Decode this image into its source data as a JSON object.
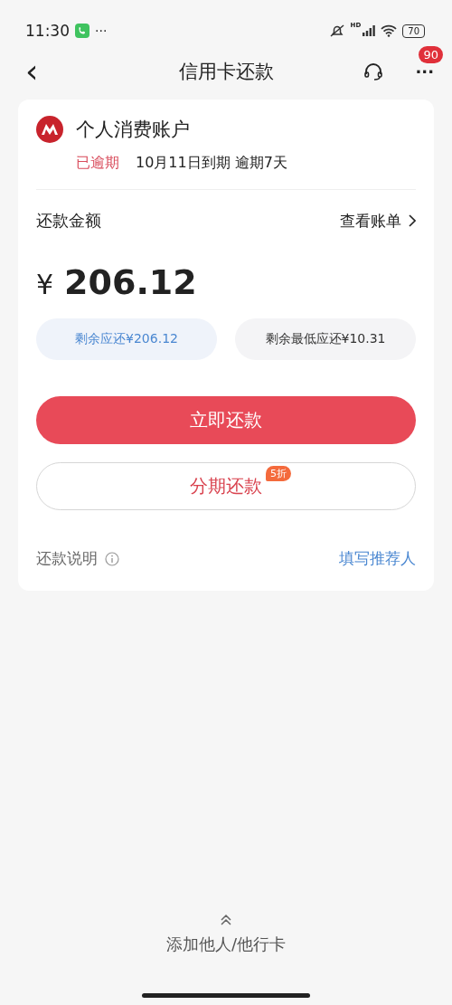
{
  "status_bar": {
    "time": "11:30",
    "more": "···",
    "network": "HD",
    "battery": "70"
  },
  "nav": {
    "back": "‹",
    "title": "信用卡还款",
    "more": "···",
    "badge": "90"
  },
  "account": {
    "name": "个人消费账户",
    "status": "已逾期",
    "due": "10月11日到期 逾期7天"
  },
  "amount_section": {
    "label": "还款金额",
    "link": "查看账单",
    "currency": "¥",
    "amount": "206.12"
  },
  "amount_options": [
    {
      "label": "剩余应还¥206.12",
      "selected": true
    },
    {
      "label": "剩余最低应还¥10.31",
      "selected": false
    }
  ],
  "primary_button": "立即还款",
  "installment_button": {
    "label": "分期还款",
    "badge": "5折"
  },
  "footer_row": {
    "note": "还款说明",
    "referrer_link": "填写推荐人"
  },
  "bottom": {
    "label": "添加他人/他行卡"
  }
}
